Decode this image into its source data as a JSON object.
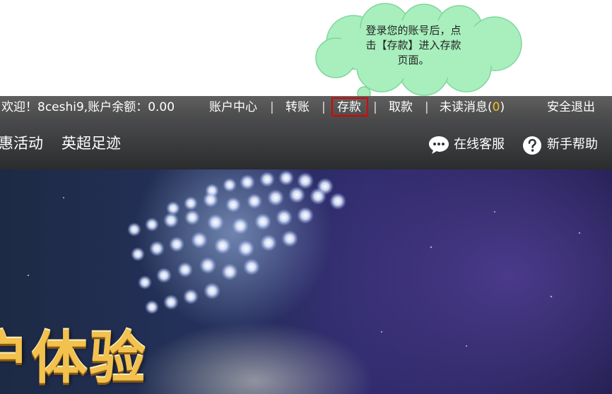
{
  "tooltip": {
    "line1": "登录您的账号后，点",
    "line2": "击【存款】进入存款",
    "line3": "页面。"
  },
  "topbar": {
    "welcome": "欢迎！8ceshi9,账户余额：0.00",
    "account_center": "账户中心",
    "transfer": "转账",
    "deposit": "存款",
    "withdraw": "取款",
    "unread_label": "未读消息",
    "unread_open": "(",
    "unread_count": "0",
    "unread_close": ")",
    "logout": "安全退出",
    "separator": "|"
  },
  "nav": {
    "promo": "惠活动",
    "epl": "英超足迹",
    "online_service": "在线客服",
    "help": "新手帮助"
  },
  "hero": {
    "text": "户体验"
  },
  "colors": {
    "highlight_border": "#e00000",
    "cloud_fill": "#a8efbd",
    "cloud_stroke": "#7fd39a",
    "unread_count": "#f5c01a"
  },
  "icons": {
    "online_service": "chat-bubble-icon",
    "help": "question-circle-icon"
  }
}
